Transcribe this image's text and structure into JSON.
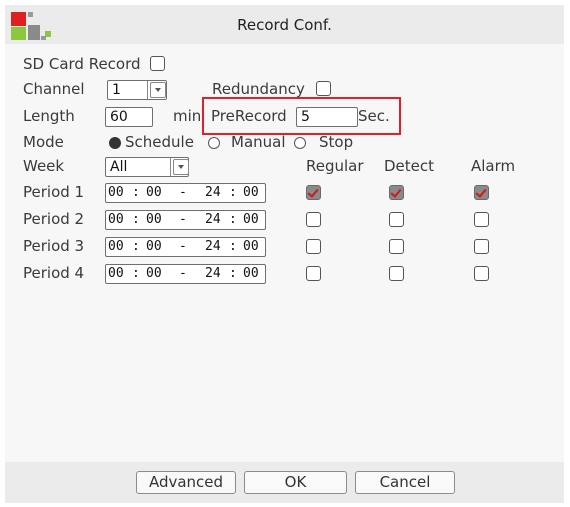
{
  "window": {
    "title": "Record Conf."
  },
  "form": {
    "sd_card_record_label": "SD Card Record",
    "channel_label": "Channel",
    "channel_value": "1",
    "redundancy_label": "Redundancy",
    "length_label": "Length",
    "length_value": "60",
    "length_unit": "min",
    "prerecord_label": "PreRecord",
    "prerecord_value": "5",
    "prerecord_unit": "Sec.",
    "mode_label": "Mode",
    "mode_options": [
      "Schedule",
      "Manual",
      "Stop"
    ],
    "mode_selected": "Schedule",
    "week_label": "Week",
    "week_value": "All"
  },
  "columns": {
    "regular": "Regular",
    "detect": "Detect",
    "alarm": "Alarm"
  },
  "periods": [
    {
      "label": "Period 1",
      "start_h": "00",
      "start_m": "00",
      "end_h": "24",
      "end_m": "00",
      "regular": true,
      "detect": true,
      "alarm": true
    },
    {
      "label": "Period 2",
      "start_h": "00",
      "start_m": "00",
      "end_h": "24",
      "end_m": "00",
      "regular": false,
      "detect": false,
      "alarm": false
    },
    {
      "label": "Period 3",
      "start_h": "00",
      "start_m": "00",
      "end_h": "24",
      "end_m": "00",
      "regular": false,
      "detect": false,
      "alarm": false
    },
    {
      "label": "Period 4",
      "start_h": "00",
      "start_m": "00",
      "end_h": "24",
      "end_m": "00",
      "regular": false,
      "detect": false,
      "alarm": false
    }
  ],
  "time_colon": ":",
  "time_dash": "-",
  "buttons": {
    "advanced": "Advanced",
    "ok": "OK",
    "cancel": "Cancel"
  },
  "colors": {
    "highlight": "#e0202a",
    "logo_red": "#e02020",
    "logo_green": "#8dc63f",
    "check_mark": "#d01818"
  }
}
